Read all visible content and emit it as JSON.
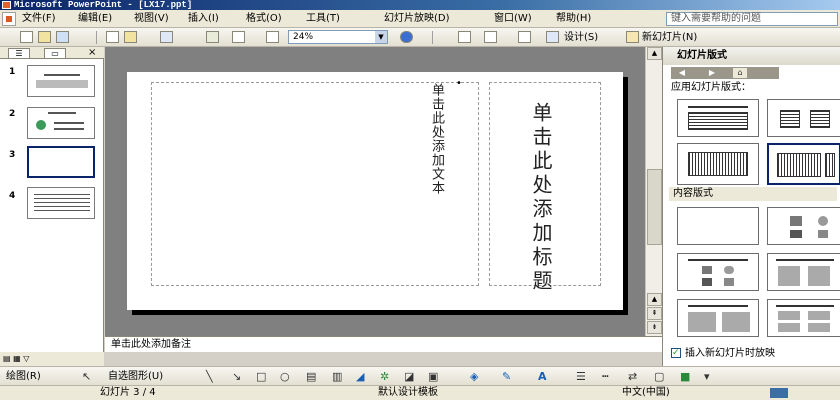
{
  "window": {
    "title": "Microsoft PowerPoint - [LX17.ppt]"
  },
  "menu": {
    "items": [
      "文件(F)",
      "编辑(E)",
      "视图(V)",
      "插入(I)",
      "格式(O)",
      "工具(T)",
      "幻灯片放映(D)",
      "窗口(W)",
      "帮助(H)"
    ],
    "help_placeholder": "键入需要帮助的问题"
  },
  "toolbar": {
    "zoom": "24%",
    "design_label": "设计(S)",
    "new_slide_label": "新幻灯片(N)"
  },
  "slides_pane": {
    "numbers": [
      "1",
      "2",
      "3",
      "4"
    ],
    "selected": 3
  },
  "slide": {
    "title_placeholder": "单击此处添加标题",
    "body_placeholder": "单击此处添加文本",
    "bullet": "•"
  },
  "notes": {
    "placeholder": "单击此处添加备注"
  },
  "task_pane": {
    "title": "幻灯片版式",
    "apply_label": "应用幻灯片版式：",
    "content_label": "内容版式",
    "insert_checkbox_label": "插入新幻灯片时放映",
    "insert_checkbox_checked": true
  },
  "drawing_toolbar": {
    "draw_label": "绘图(R)",
    "autoshape_label": "自选图形(U)"
  },
  "status": {
    "slide_info": "幻灯片 3 / 4",
    "template": "默认设计模板",
    "language": "中文(中国)"
  }
}
